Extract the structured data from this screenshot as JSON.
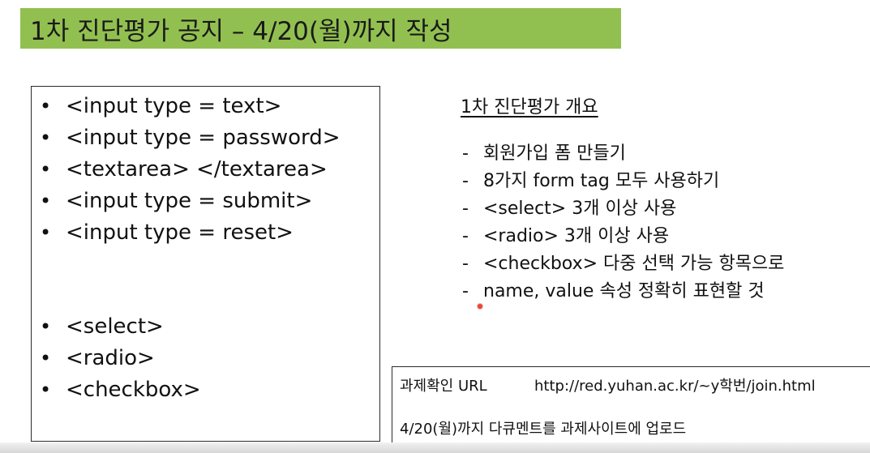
{
  "title": "1차 진단평가 공지 – 4/20(월)까지 작성",
  "tag_list": [
    {
      "bullet": "•",
      "text": "<input type = text>"
    },
    {
      "bullet": "•",
      "text": "<input type = password>"
    },
    {
      "bullet": "•",
      "text": "<textarea> </textarea>"
    },
    {
      "bullet": "•",
      "text": "<input type = submit>"
    },
    {
      "bullet": "•",
      "text": "<input type = reset>"
    },
    {
      "bullet": "•",
      "text": "<select>"
    },
    {
      "bullet": "•",
      "text": "<radio>"
    },
    {
      "bullet": "•",
      "text": "<checkbox>"
    }
  ],
  "overview": {
    "title": "1차 진단평가 개요",
    "items": [
      {
        "dash": "-",
        "text": "회원가입 폼 만들기"
      },
      {
        "dash": "-",
        "text": "8가지 form tag 모두 사용하기"
      },
      {
        "dash": "-",
        "text": "<select> 3개 이상 사용"
      },
      {
        "dash": "-",
        "text": "<radio> 3개 이상 사용"
      },
      {
        "dash": "-",
        "text": "<checkbox> 다중 선택 가능 항목으로"
      },
      {
        "dash": "-",
        "text": "name, value 속성 정확히 표현할 것"
      }
    ]
  },
  "info": {
    "url_label": "과제확인 URL",
    "url": "http://red.yuhan.ac.kr/~y학번/join.html",
    "upload_note": "4/20(월)까지 다큐멘트를 과제사이트에 업로드"
  },
  "colors": {
    "title_bg": "#92c050",
    "pointer_dot": "#e8453c"
  }
}
